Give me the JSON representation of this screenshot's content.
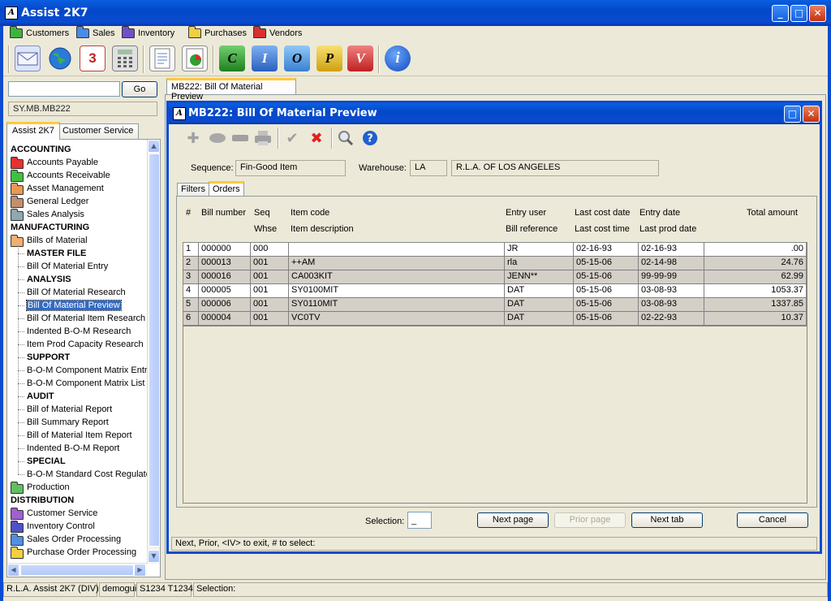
{
  "app": {
    "title": "Assist 2K7",
    "icon_letters": "A"
  },
  "menubar": [
    {
      "label": "Customers",
      "color": "#3cb43c"
    },
    {
      "label": "Sales",
      "color": "#4a8ae8"
    },
    {
      "label": "Inventory",
      "color": "#7050c8"
    },
    {
      "label": "Purchases",
      "color": "#f0d040"
    },
    {
      "label": "Vendors",
      "color": "#d83030"
    }
  ],
  "toolbar": {
    "icons": [
      "mail-icon",
      "globe-icon",
      "calendar-icon",
      "calculator-icon",
      "report-icon",
      "chart-icon",
      "c-icon",
      "i-icon",
      "o-icon",
      "p-icon",
      "v-icon",
      "info-icon"
    ],
    "calendar_number": "3",
    "letters": [
      "C",
      "I",
      "O",
      "P",
      "V"
    ],
    "info": "i"
  },
  "left": {
    "search_value": "",
    "go_label": "Go",
    "path": "SY.MB.MB222",
    "tabs": [
      "Assist 2K7",
      "Customer Service"
    ],
    "tree": [
      {
        "type": "hdr",
        "label": "ACCOUNTING"
      },
      {
        "type": "folder",
        "label": "Accounts Payable",
        "color": "#e83030"
      },
      {
        "type": "folder",
        "label": "Accounts Receivable",
        "color": "#40c040"
      },
      {
        "type": "folder",
        "label": "Asset Management",
        "color": "#e89850"
      },
      {
        "type": "folder",
        "label": "General Ledger",
        "color": "#c09070"
      },
      {
        "type": "folder",
        "label": "Sales Analysis",
        "color": "#90a8b0"
      },
      {
        "type": "hdr",
        "label": "MANUFACTURING"
      },
      {
        "type": "folder",
        "label": "Bills of Material",
        "color": "#f0b070"
      },
      {
        "type": "sub-hdr",
        "label": "MASTER FILE"
      },
      {
        "type": "leaf",
        "label": "Bill Of Material Entry"
      },
      {
        "type": "sub-hdr",
        "label": "ANALYSIS"
      },
      {
        "type": "leaf",
        "label": "Bill Of Material Research"
      },
      {
        "type": "leaf-sel",
        "label": "Bill Of Material Preview"
      },
      {
        "type": "leaf",
        "label": "Bill Of Material Item Research"
      },
      {
        "type": "leaf",
        "label": "Indented B-O-M Research"
      },
      {
        "type": "leaf",
        "label": "Item Prod Capacity Research"
      },
      {
        "type": "sub-hdr",
        "label": "SUPPORT"
      },
      {
        "type": "leaf",
        "label": "B-O-M Component Matrix Entry"
      },
      {
        "type": "leaf",
        "label": "B-O-M Component Matrix List"
      },
      {
        "type": "sub-hdr",
        "label": "AUDIT"
      },
      {
        "type": "leaf",
        "label": "Bill of Material Report"
      },
      {
        "type": "leaf",
        "label": "Bill Summary Report"
      },
      {
        "type": "leaf",
        "label": "Bill of Material Item Report"
      },
      {
        "type": "leaf",
        "label": "Indented B-O-M Report"
      },
      {
        "type": "sub-hdr",
        "label": "SPECIAL"
      },
      {
        "type": "leaf",
        "label": "B-O-M Standard Cost Regulato"
      },
      {
        "type": "folder",
        "label": "Production",
        "color": "#60c060"
      },
      {
        "type": "hdr",
        "label": "DISTRIBUTION"
      },
      {
        "type": "folder",
        "label": "Customer Service",
        "color": "#a060d0"
      },
      {
        "type": "folder",
        "label": "Inventory Control",
        "color": "#5050c8"
      },
      {
        "type": "folder",
        "label": "Sales Order Processing",
        "color": "#5090e0"
      },
      {
        "type": "folder",
        "label": "Purchase Order Processing",
        "color": "#f0d040"
      }
    ]
  },
  "doc_tab": "MB222: Bill Of Material Preview",
  "window": {
    "title": "MB222: Bill Of Material Preview",
    "sequence_label": "Sequence:",
    "sequence_value": "Fin-Good Item",
    "warehouse_label": "Warehouse:",
    "warehouse_code": "LA",
    "warehouse_name": "R.L.A. OF LOS ANGELES",
    "tabs": [
      "Filters",
      "Orders"
    ],
    "columns_line1": [
      "#",
      "Bill number",
      "Seq",
      "Item code",
      "Entry user",
      "Last cost date",
      "Entry date",
      "Total amount"
    ],
    "columns_line2": [
      "Whse",
      "Item description",
      "Bill reference",
      "Last cost time",
      "Last prod date"
    ],
    "rows": [
      [
        "1",
        "000000",
        "000",
        "",
        "JR",
        "02-16-93",
        "02-16-93",
        ".00"
      ],
      [
        "2",
        "000013",
        "001",
        "++AM",
        "rla",
        "05-15-06",
        "02-14-98",
        "24.76"
      ],
      [
        "3",
        "000016",
        "001",
        "CA003KIT",
        "JENN**",
        "05-15-06",
        "99-99-99",
        "62.99"
      ],
      [
        "4",
        "000005",
        "001",
        "SY0100MIT",
        "DAT",
        "05-15-06",
        "03-08-93",
        "1053.37"
      ],
      [
        "5",
        "000006",
        "001",
        "SY0110MIT",
        "DAT",
        "05-15-06",
        "03-08-93",
        "1337.85"
      ],
      [
        "6",
        "000004",
        "001",
        "VC0TV",
        "DAT",
        "05-15-06",
        "02-22-93",
        "10.37"
      ]
    ],
    "selection_label": "Selection:",
    "selection_value": "_",
    "buttons": {
      "next_page": "Next page",
      "prior_page": "Prior page",
      "next_tab": "Next tab",
      "cancel": "Cancel"
    },
    "status": "Next,  Prior,  <IV> to exit,  # to select:"
  },
  "statusbar": [
    "R.L.A. Assist 2K7 (DIV)",
    "demogui",
    "S1234 T1234",
    "Selection:"
  ]
}
